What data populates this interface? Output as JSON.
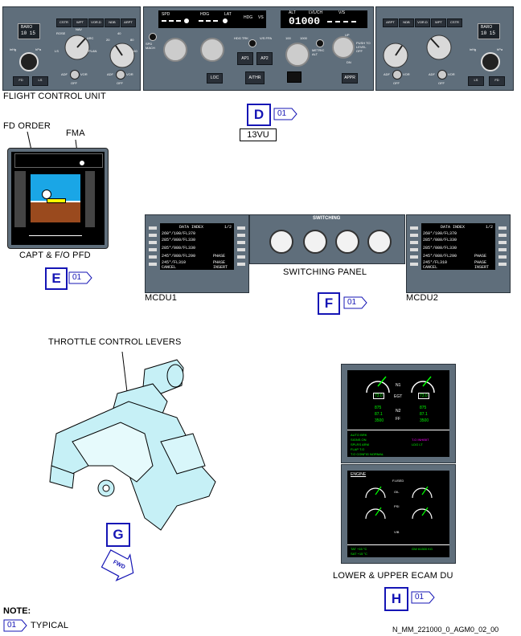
{
  "fcu": {
    "caption": "FLIGHT CONTROL UNIT",
    "left_efis": {
      "baro_label": "BARO",
      "baro_value": "10 15",
      "buttons": [
        "CSTR",
        "WPT",
        "VOR.D",
        "NDB",
        "ARPT"
      ],
      "mode_labels": [
        "ROSE",
        "NAV",
        "VOR",
        "ARC",
        "LS",
        "PLAN"
      ],
      "ranges": [
        "10",
        "20",
        "40",
        "80",
        "160",
        "320"
      ],
      "adf_vor": [
        "ADF",
        "VOR"
      ],
      "off": "OFF",
      "inhg": "inHg",
      "hpa": "hPa",
      "fd": "FD",
      "ls": "LS"
    },
    "center": {
      "spd": "SPD",
      "hdg": "HDG",
      "lat": "LAT",
      "hdg2": "HDG",
      "vs": "VS",
      "alt": "ALT",
      "lvl_ch": "LVL/CH",
      "vs2": "V/S",
      "alt_value": "01000",
      "spd_mach": "SPD MACH",
      "hdg_trk": "HDG TRK",
      "vs_fpa": "V/S FPA",
      "ap1": "AP1",
      "ap2": "AP2",
      "athr": "A/THR",
      "loc": "LOC",
      "alt_100": "100",
      "alt_1000": "1000",
      "metric_alt": "METRIC ALT",
      "up": "UP",
      "push_to_level_off": "PUSH TO LEVEL OFF",
      "dn": "DN",
      "appr": "APPR"
    },
    "right_efis": {
      "baro_label": "BARO",
      "baro_value": "10 15",
      "buttons": [
        "ARPT",
        "NDB",
        "VOR.D",
        "WPT",
        "CSTR"
      ],
      "ls": "LS",
      "fd": "FD"
    }
  },
  "section_d": {
    "letter": "D",
    "effectivity": "01",
    "panel_id": "13VU"
  },
  "pfd": {
    "caption": "CAPT & F/O PFD",
    "fd_order": "FD ORDER",
    "fma": "FMA"
  },
  "section_e": {
    "letter": "E",
    "effectivity": "01"
  },
  "mcdu": {
    "left_caption": "MCDU1",
    "right_caption": "MCDU2",
    "switching_caption": "SWITCHING PANEL",
    "switching_title": "SWITCHING",
    "screen_title": "DATA INDEX",
    "screen_page": "1/2",
    "lines": [
      "260°/100/FL370",
      "285°/080/FL330",
      "285°/080/FL330",
      "245°/080/FL290",
      "245°/FL310"
    ],
    "right_text": [
      "PHASE",
      "PHASE",
      "INSERT"
    ],
    "cancel": "CANCEL"
  },
  "section_f": {
    "letter": "F",
    "effectivity": "01"
  },
  "throttle": {
    "caption": "THROTTLE CONTROL LEVERS"
  },
  "section_g": {
    "letter": "G",
    "fwd": "FWD"
  },
  "ecam": {
    "caption": "LOWER & UPPER ECAM DU",
    "n1": "N1",
    "egt": "EGT",
    "n2": "N2",
    "ff": "FF",
    "n1_values": [
      "73.0",
      "73.0"
    ],
    "egt_values": [
      "875",
      "875"
    ],
    "n2_values": [
      "87.1",
      "87.1"
    ],
    "ff_values": [
      "3500",
      "3500"
    ],
    "engine": "ENGINE",
    "fused": "F.USED",
    "oil": "OIL",
    "psi": "PSI",
    "vib": "VIB",
    "memo_left": [
      "AUTO BRK",
      "SIGNS ON",
      "SPLRS ARM",
      "FLAP T.O",
      "T.O CONFIG NORMAL"
    ],
    "memo_right": [
      "T.O INHIBIT",
      "LDG LT"
    ],
    "tat": "TAT +15 °C",
    "sat": "SAT +15 °C",
    "gw": "GW 61500 KG"
  },
  "section_h": {
    "letter": "H",
    "effectivity": "01"
  },
  "note": {
    "title": "NOTE:",
    "effectivity": "01",
    "text": "TYPICAL"
  },
  "figure_id": "N_MM_221000_0_AGM0_02_00"
}
